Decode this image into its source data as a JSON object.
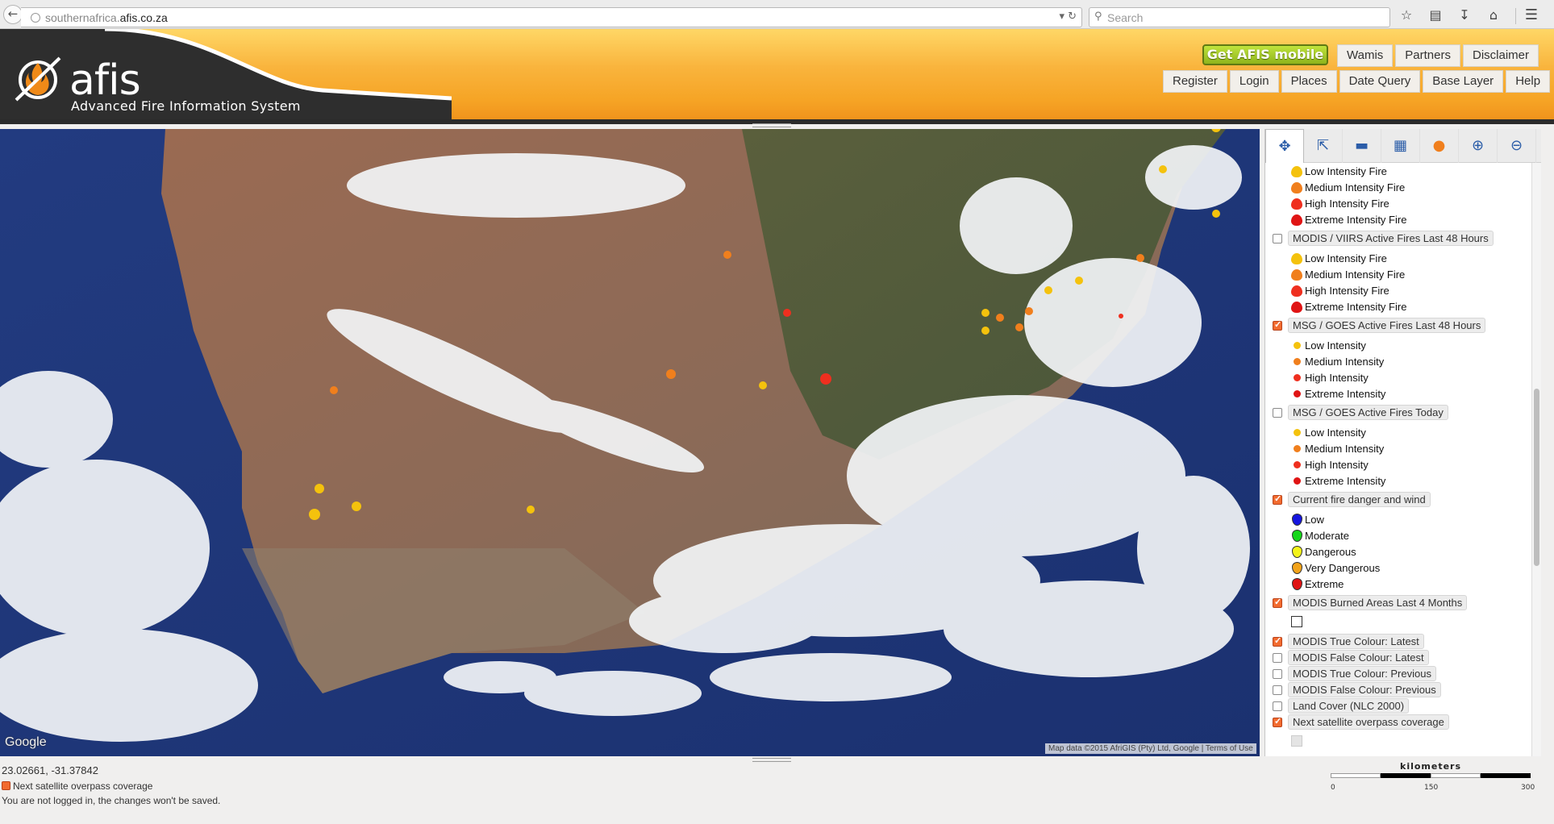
{
  "browser": {
    "url_prefix": "southernafrica.",
    "url_domain": "afis.co.za",
    "search_placeholder": "Search"
  },
  "header": {
    "logo_text": "afis",
    "logo_subtitle": "Advanced Fire Information System",
    "mobile_button": "Get AFIS mobile",
    "nav_top": [
      "Wamis",
      "Partners",
      "Disclaimer"
    ],
    "nav_bottom": [
      "Register",
      "Login",
      "Places",
      "Date Query",
      "Base Layer",
      "Help"
    ]
  },
  "map": {
    "google": "Google",
    "credit": "Map data ©2015 AfriGIS (Pty) Ltd, Google",
    "terms": "Terms of Use"
  },
  "colors": {
    "low": "#f4c20d",
    "medium": "#f07f1d",
    "high": "#ef2f1f",
    "extreme": "#e01414",
    "danger_low": "#1515e0",
    "danger_moderate": "#16d61a",
    "danger_dangerous": "#f4f41a",
    "danger_very": "#f2a31a",
    "danger_extreme": "#e01414",
    "accent_checkbox": "#f26b2f"
  },
  "legend": {
    "fire_items_top": [
      "Low Intensity Fire",
      "Medium Intensity Fire",
      "High Intensity Fire",
      "Extreme Intensity Fire"
    ],
    "layer_modis_48": "MODIS / VIIRS Active Fires Last 48 Hours",
    "fire_items_modis": [
      "Low Intensity Fire",
      "Medium Intensity Fire",
      "High Intensity Fire",
      "Extreme Intensity Fire"
    ],
    "layer_msg_48": "MSG / GOES Active Fires Last 48 Hours",
    "msg_items_48": [
      "Low Intensity",
      "Medium Intensity",
      "High Intensity",
      "Extreme Intensity"
    ],
    "layer_msg_today": "MSG / GOES Active Fires Today",
    "msg_items_today": [
      "Low Intensity",
      "Medium Intensity",
      "High Intensity",
      "Extreme Intensity"
    ],
    "layer_danger": "Current fire danger and wind",
    "danger_items": [
      "Low",
      "Moderate",
      "Dangerous",
      "Very Dangerous",
      "Extreme"
    ],
    "layer_burned": "MODIS Burned Areas Last 4 Months",
    "layer_true_latest": "MODIS True Colour: Latest",
    "layer_false_latest": "MODIS False Colour: Latest",
    "layer_true_prev": "MODIS True Colour: Previous",
    "layer_false_prev": "MODIS False Colour: Previous",
    "layer_landcover": "Land Cover (NLC 2000)",
    "layer_overpass": "Next satellite overpass coverage"
  },
  "status": {
    "coords": "23.02661, -31.37842",
    "layer": "Next satellite overpass coverage",
    "login_note": "You are not logged in, the changes won't be saved."
  },
  "scale": {
    "title": "kilometers",
    "ticks": [
      "0",
      "150",
      "300"
    ]
  }
}
